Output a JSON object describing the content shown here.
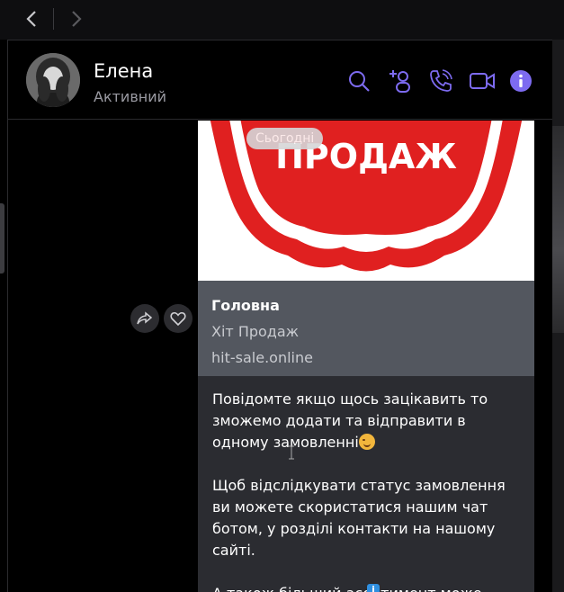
{
  "nav": {
    "back_icon": "chevron-left-icon",
    "forward_icon": "chevron-right-icon"
  },
  "header": {
    "name": "Елена",
    "status": "Активний",
    "icons": [
      "search-icon",
      "add-user-icon",
      "phone-icon",
      "video-icon",
      "info-icon"
    ],
    "accent_color": "#7d6bf0"
  },
  "chat": {
    "date_chip": "Сьогодні",
    "image_text": "ПРОДАЖ",
    "link_preview": {
      "title": "Головна",
      "subtitle": "Хіт Продаж",
      "url": "hit-sale.online"
    },
    "message": {
      "p1": "Повідомте якщо щось зацікавить то зможемо додати та відправити в одному замовленні",
      "p2": "Щоб відслідкувати статус замовлення ви можете скористатися нашим чат ботом, у розділі контакти на нашому сайті.",
      "p3": "А також більший асортимент може"
    },
    "actions": [
      "share-icon",
      "heart-icon"
    ]
  }
}
